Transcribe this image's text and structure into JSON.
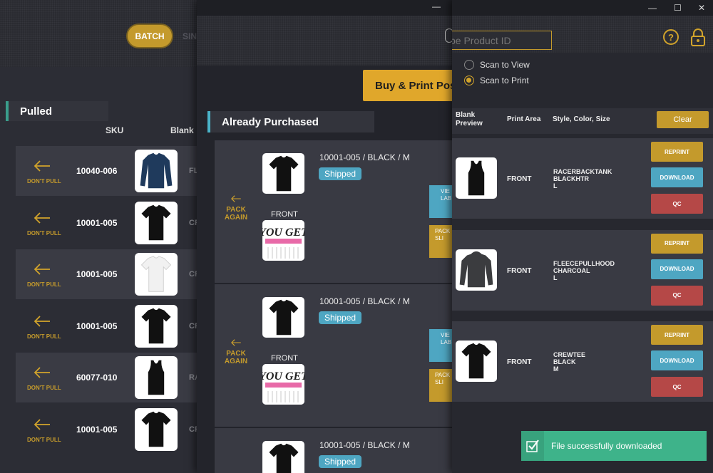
{
  "pulled_window": {
    "mode_batch": "BATCH",
    "mode_single": "SIN",
    "section_title": "Pulled",
    "col_sku": "SKU",
    "col_blank": "Blank",
    "dont_pull": "DON'T PULL",
    "rows": [
      {
        "sku": "10040-006",
        "blank": "FL",
        "garment": "sweater",
        "color": "#1f3a5c"
      },
      {
        "sku": "10001-005",
        "blank": "CR",
        "garment": "tee",
        "color": "#111111"
      },
      {
        "sku": "10001-005",
        "blank": "CR",
        "garment": "tee",
        "color": "#f1f1f1"
      },
      {
        "sku": "10001-005",
        "blank": "CR",
        "garment": "tee",
        "color": "#111111"
      },
      {
        "sku": "60077-010",
        "blank": "RA",
        "garment": "tank",
        "color": "#111111"
      },
      {
        "sku": "10001-005",
        "blank": "CR",
        "garment": "tee",
        "color": "#111111"
      }
    ]
  },
  "purchased_window": {
    "buy_button": "Buy & Print Pos",
    "section_title": "Already Purchased",
    "pack_again": "PACK AGAIN",
    "view_label": "VIE LAB",
    "pack_slip": "PACK SLI",
    "orders": [
      {
        "title": "10001-005 / BLACK / M",
        "status": "Shipped",
        "print_area": "FRONT",
        "design_text": "YOU GET"
      },
      {
        "title": "10001-005 / BLACK / M",
        "status": "Shipped",
        "print_area": "FRONT",
        "design_text": "YOU GET"
      },
      {
        "title": "10001-005 / BLACK / M",
        "status": "Shipped",
        "print_area": "",
        "design_text": ""
      }
    ]
  },
  "print_window": {
    "product_id_placeholder": "pe Product ID",
    "scan_to_view": "Scan to View",
    "scan_to_print": "Scan to Print",
    "selected_scan": "Scan to Print",
    "th_blank": "Blank",
    "th_preview": "Preview",
    "th_area": "Print Area",
    "th_style": "Style, Color, Size",
    "clear": "Clear",
    "reprint": "REPRINT",
    "download": "DOWNLOAD",
    "qc": "QC",
    "items": [
      {
        "area": "FRONT",
        "style": "RACERBACKTANK",
        "color": "BLACKHTR",
        "size": "L",
        "garment": "tank"
      },
      {
        "area": "FRONT",
        "style": "FLEECEPULLHOOD",
        "color": "CHARCOAL",
        "size": "L",
        "garment": "hoodie"
      },
      {
        "area": "FRONT",
        "style": "CREWTEE",
        "color": "BLACK",
        "size": "M",
        "garment": "tee"
      }
    ],
    "toast": "File successfully downloaded"
  },
  "colors": {
    "gold": "#c49a2c",
    "teal": "#4ea6c2",
    "red": "#b54847",
    "green": "#3eb38a"
  }
}
